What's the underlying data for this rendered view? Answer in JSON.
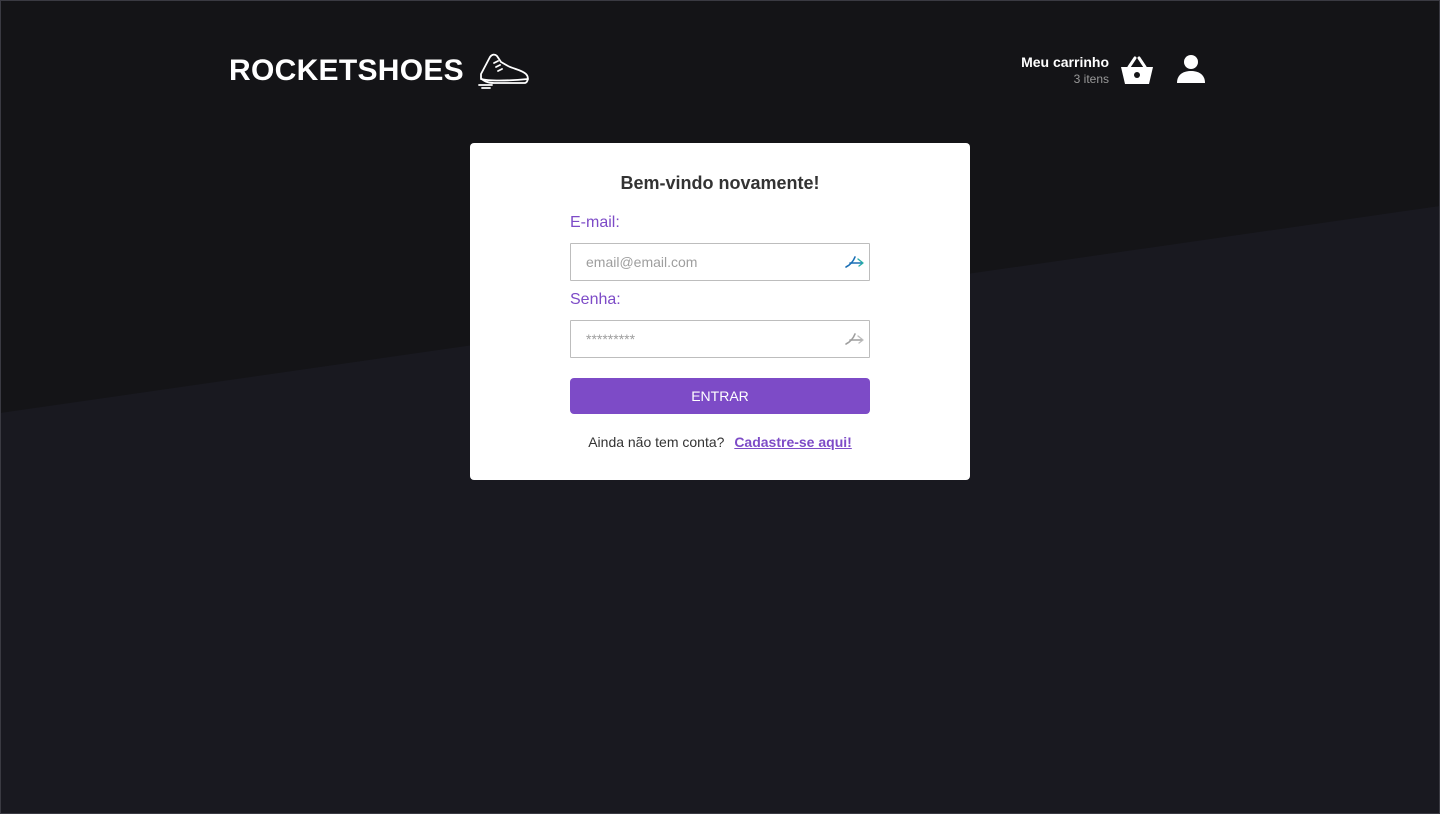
{
  "header": {
    "logo_text": "ROCKETSHOES",
    "logo_icon": "sneaker-icon",
    "cart": {
      "title": "Meu carrinho",
      "count": "3 itens",
      "icon": "basket-icon"
    },
    "user_icon": "user-icon"
  },
  "login": {
    "title": "Bem-vindo novamente!",
    "email": {
      "label": "E-mail:",
      "placeholder": "email@email.com",
      "icon": "autofill-key-icon"
    },
    "password": {
      "label": "Senha:",
      "placeholder": "*********",
      "icon": "autofill-key-icon"
    },
    "submit_label": "ENTRAR",
    "signup_prompt": "Ainda não tem conta?",
    "signup_link": "Cadastre-se aqui!"
  },
  "colors": {
    "accent": "#7d4bc7",
    "background": "#191920",
    "background_top": "#141417",
    "card": "#ffffff"
  }
}
